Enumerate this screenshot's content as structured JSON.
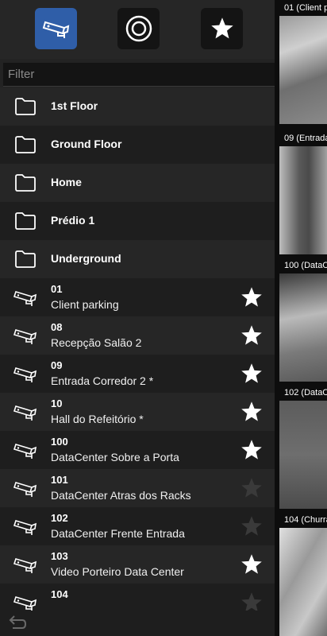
{
  "toolbar": {
    "buttons": [
      {
        "icon": "cctv-camera-icon",
        "active": true
      },
      {
        "icon": "target-circle-icon",
        "active": false
      },
      {
        "icon": "star-icon",
        "active": false
      }
    ]
  },
  "filter": {
    "placeholder": "Filter",
    "value": ""
  },
  "folders": [
    {
      "label": "1st Floor"
    },
    {
      "label": "Ground Floor"
    },
    {
      "label": "Home"
    },
    {
      "label": "Prédio 1"
    },
    {
      "label": "Underground"
    }
  ],
  "cameras": [
    {
      "number": "01",
      "name": "Client parking",
      "favorite": true
    },
    {
      "number": "08",
      "name": "Recepção Salão 2",
      "favorite": true
    },
    {
      "number": "09",
      "name": "Entrada Corredor 2 *",
      "favorite": true
    },
    {
      "number": "10",
      "name": "Hall do Refeitório *",
      "favorite": true
    },
    {
      "number": "100",
      "name": "DataCenter Sobre a Porta",
      "favorite": true
    },
    {
      "number": "101",
      "name": "DataCenter Atras dos Racks",
      "favorite": false
    },
    {
      "number": "102",
      "name": "DataCenter Frente Entrada",
      "favorite": false
    },
    {
      "number": "103",
      "name": "Video Porteiro Data Center",
      "favorite": true
    },
    {
      "number": "104",
      "name": "",
      "favorite": false
    }
  ],
  "previews": [
    {
      "label": "01 (Client p"
    },
    {
      "label": "09 (Entrada"
    },
    {
      "label": "100 (DataC"
    },
    {
      "label": "102 (DataC"
    },
    {
      "label": "104 (Churra"
    }
  ],
  "colors": {
    "accent": "#2f5ea8",
    "background": "#232323",
    "favorite_on": "#ffffff",
    "favorite_off": "#3a3a3a"
  }
}
